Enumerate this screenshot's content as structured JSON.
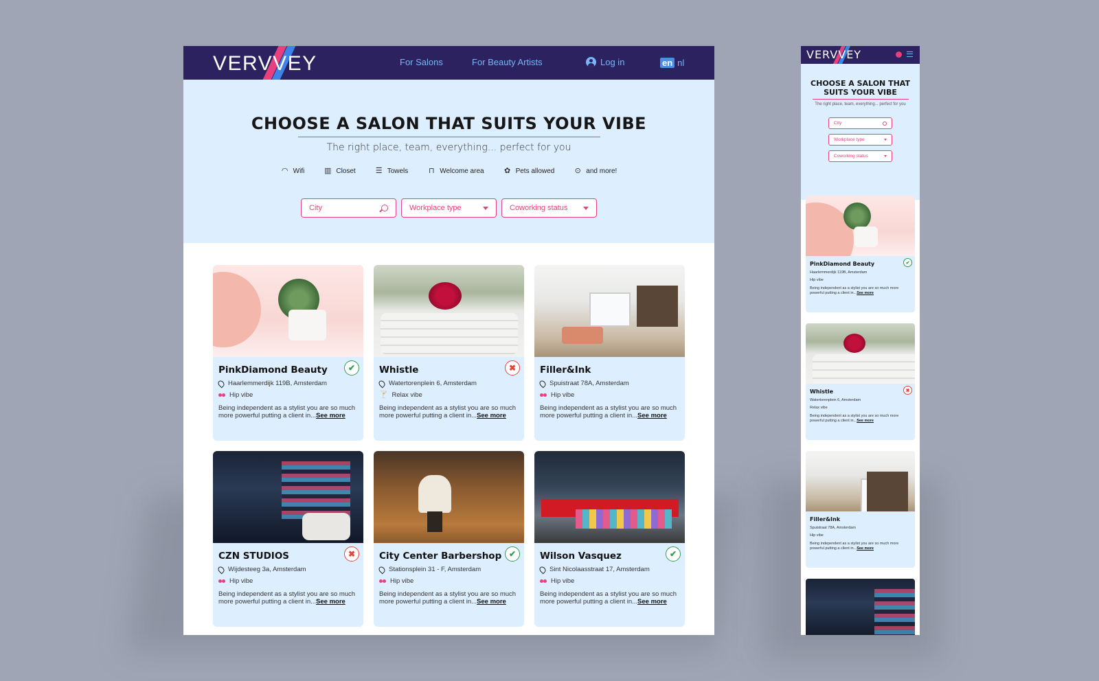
{
  "brand": {
    "name": "VERVVEY"
  },
  "nav": {
    "salons": "For Salons",
    "artists": "For Beauty Artists",
    "login": "Log in",
    "lang_active": "en",
    "lang_other": "nl"
  },
  "hero": {
    "title": "CHOOSE A SALON THAT SUITS YOUR VIBE",
    "subtitle": "The right place, team, everything... perfect for you",
    "amenities": [
      "Wifi",
      "Closet",
      "Towels",
      "Welcome area",
      "Pets allowed",
      "and more!"
    ]
  },
  "filters": {
    "city": "City",
    "workplace": "Workplace type",
    "coworking": "Coworking status"
  },
  "cards": [
    {
      "name": "PinkDiamond Beauty",
      "address": "Haarlemmerdijk 119B, Amsterdam",
      "vibe": "Hip vibe",
      "status": "available",
      "desc": "Being independent as a stylist you are so much more powerful putting a client in...",
      "more": "See more"
    },
    {
      "name": "Whistle",
      "address": "Watertorenplein 6, Amsterdam",
      "vibe": "Relax vibe",
      "status": "unavailable",
      "desc": "Being independent as a stylist you are so much more powerful putting a client in...",
      "more": "See more"
    },
    {
      "name": "Filler&Ink",
      "address": "Spuistraat 78A, Amsterdam",
      "vibe": "Hip vibe",
      "status": "none",
      "desc": "Being independent as a stylist you are so much more powerful putting a client in...",
      "more": "See more"
    },
    {
      "name": "CZN STUDIOS",
      "address": "Wijdesteeg 3a, Amsterdam",
      "vibe": "Hip vibe",
      "status": "unavailable",
      "desc": "Being independent as a stylist you are so much more powerful putting a client in...",
      "more": "See more"
    },
    {
      "name": "City Center Barbershop",
      "address": "Stationsplein 31 - F, Amsterdam",
      "vibe": "Hip vibe",
      "status": "available",
      "desc": "Being independent as a stylist you are so much more powerful putting a client in...",
      "more": "See more"
    },
    {
      "name": "Wilson Vasquez",
      "address": "Sint Nicolaasstraat 17, Amsterdam",
      "vibe": "Hip vibe",
      "status": "available",
      "desc": "Being independent as a stylist you are so much more powerful putting a client in...",
      "more": "See more"
    }
  ],
  "colors": {
    "nav_bg": "#2c2260",
    "accent_pink": "#e8407f",
    "accent_blue": "#79b6f7",
    "hero_bg": "#ddeeff",
    "ok": "#2e9e4f",
    "no": "#e0473c"
  },
  "icons": {
    "ok": "✔",
    "no": "✖"
  }
}
